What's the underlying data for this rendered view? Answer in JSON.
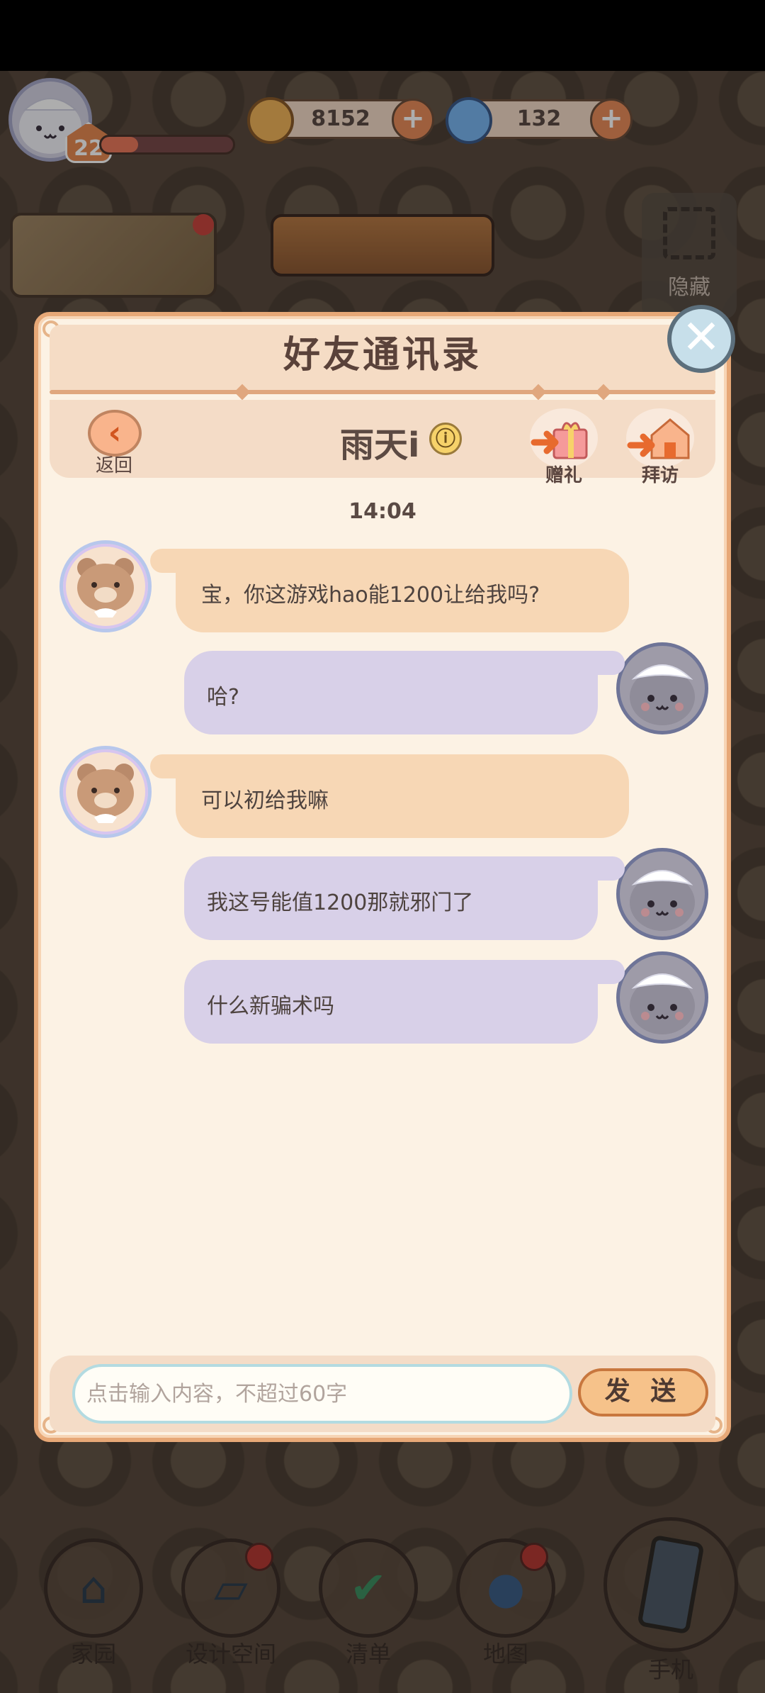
{
  "hud": {
    "level": "22",
    "level_progress": 0.28,
    "coins": "8152",
    "gems": "132"
  },
  "hide_button": {
    "label": "隐藏"
  },
  "dialog": {
    "title": "好友通讯录",
    "back_label": "返回",
    "friend_name": "雨天i",
    "info_icon": "ⓘ",
    "gift_label": "赠礼",
    "visit_label": "拜访",
    "timestamp": "14:04",
    "messages": [
      {
        "sender": "friend",
        "text": "宝，你这游戏hao能1200让给我吗?"
      },
      {
        "sender": "me",
        "text": "哈?"
      },
      {
        "sender": "friend",
        "text": "可以初给我嘛"
      },
      {
        "sender": "me",
        "text": "我这号能值1200那就邪门了"
      },
      {
        "sender": "me",
        "text": "什么新骗术吗"
      }
    ],
    "input_placeholder": "点击输入内容，不超过60字",
    "send_label": "发 送"
  },
  "bottom_nav": [
    {
      "label": "家园",
      "icon": "home-icon"
    },
    {
      "label": "设计空间",
      "icon": "design-icon"
    },
    {
      "label": "清单",
      "icon": "checklist-icon"
    },
    {
      "label": "地图",
      "icon": "map-pin-icon"
    },
    {
      "label": "手机",
      "icon": "phone-icon"
    }
  ],
  "colors": {
    "dialog_bg": "#fcf2e4",
    "friend_bubble": "#f7d7b5",
    "my_bubble": "#d8d0e8",
    "accent_orange": "#e98d5a"
  }
}
